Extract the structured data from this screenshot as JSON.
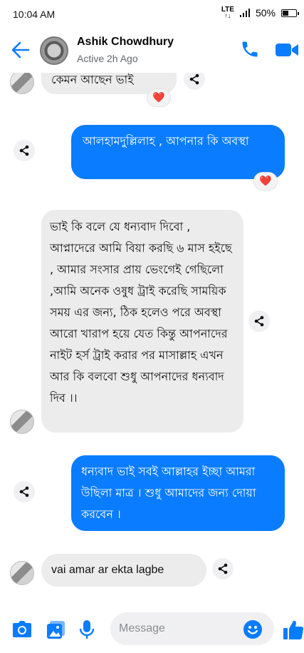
{
  "status_bar": {
    "time": "10:04 AM",
    "network": "LTE",
    "battery": "50%"
  },
  "header": {
    "name": "Ashik Chowdhury",
    "status": "Active 2h Ago"
  },
  "messages": [
    {
      "text": "কেমন আছেন ভাই",
      "reaction": "❤️"
    },
    {
      "text": "আলহামদুল্লিলাহ , আপনার কি অবস্থা",
      "reaction": "❤️"
    },
    {
      "text": "ভাই কি বলে যে ধন্যবাদ দিবো , আপ্নাদেরে আমি বিয়া করছি ৬ মাস হইছে , আমার সংসার প্রায় ভেংগেই গেছিলো ,আমি অনেক ওষুধ ট্রাই করেছি সাময়িক সময় এর জন্য, ঠিক হলেও পরে অবস্থা আরো খারাপ হয়ে যেত কিন্তু আপনাদের নাইট হর্স ট্রাই করার পর মাসাল্লাহ এখন আর কি বলবো শুধু আপনাদের ধন্যবাদ দিব ।।"
    },
    {
      "text": "ধন্যবাদ ভাই সবই আল্লাহর ইচ্ছা আমরা উছিলা মাত্র । শুধু আমাদের জন্য দোয়া করবেন ।"
    },
    {
      "text": "vai amar ar ekta lagbe"
    }
  ],
  "composer": {
    "placeholder": "Message"
  },
  "colors": {
    "accent": "#0a7cff",
    "incoming": "#ececec",
    "heart": "#e0245e"
  }
}
